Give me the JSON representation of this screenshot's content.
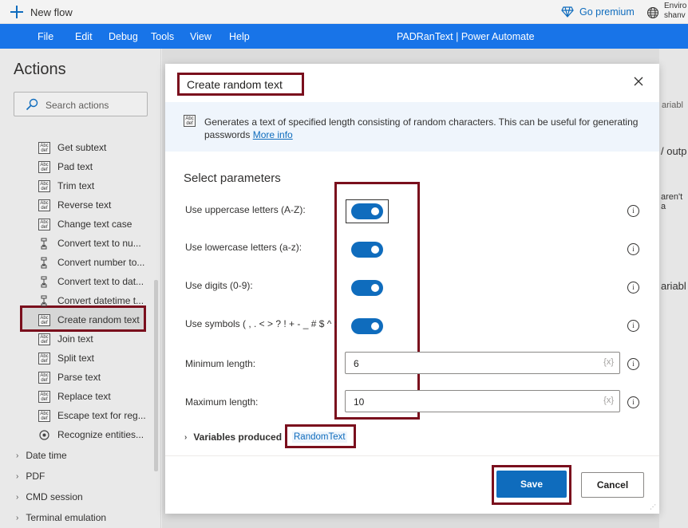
{
  "topbar": {
    "new_flow": "New flow",
    "go_premium": "Go premium",
    "env_line1": "Enviro",
    "env_line2": "shanv"
  },
  "menubar": {
    "items": [
      "File",
      "Edit",
      "Debug",
      "Tools",
      "View",
      "Help"
    ],
    "app_title": "PADRanText | Power Automate"
  },
  "actions": {
    "title": "Actions",
    "search_placeholder": "Search actions",
    "items": [
      {
        "label": "Get subtext",
        "icon": "abc-icon"
      },
      {
        "label": "Pad text",
        "icon": "abc-icon"
      },
      {
        "label": "Trim text",
        "icon": "abc-icon"
      },
      {
        "label": "Reverse text",
        "icon": "abc-icon"
      },
      {
        "label": "Change text case",
        "icon": "abc-icon"
      },
      {
        "label": "Convert text to nu...",
        "icon": "convert-icon"
      },
      {
        "label": "Convert number to...",
        "icon": "convert-icon"
      },
      {
        "label": "Convert text to dat...",
        "icon": "convert-icon"
      },
      {
        "label": "Convert datetime t...",
        "icon": "convert-icon"
      },
      {
        "label": "Create random text",
        "icon": "abc-icon"
      },
      {
        "label": "Join text",
        "icon": "abc-icon"
      },
      {
        "label": "Split text",
        "icon": "abc-icon"
      },
      {
        "label": "Parse text",
        "icon": "abc-icon"
      },
      {
        "label": "Replace text",
        "icon": "abc-icon"
      },
      {
        "label": "Escape text for reg...",
        "icon": "abc-icon"
      },
      {
        "label": "Recognize entities...",
        "icon": "recognize-icon"
      }
    ],
    "groups": [
      "Date time",
      "PDF",
      "CMD session",
      "Terminal emulation"
    ]
  },
  "background": {
    "var_tab_partial": "/ outp",
    "var_text_partial": "aren't a",
    "variables_partial": "ariabl",
    "variables2_partial": "ariabl"
  },
  "dialog": {
    "title": "Create random text",
    "description": "Generates a text of specified length consisting of random characters. This can be useful for generating passwords",
    "more_info": "More info",
    "section_title": "Select parameters",
    "params": [
      {
        "label": "Use uppercase letters (A-Z):",
        "enabled": true
      },
      {
        "label": "Use lowercase letters (a-z):",
        "enabled": true
      },
      {
        "label": "Use digits (0-9):",
        "enabled": true
      },
      {
        "label": "Use symbols ( , . < > ? ! + - _ # $ ^ :",
        "enabled": true
      }
    ],
    "min_length_label": "Minimum length:",
    "min_length_value": "6",
    "max_length_label": "Maximum length:",
    "max_length_value": "10",
    "var_token": "{x}",
    "variables_produced_label": "Variables produced",
    "variable_name": "RandomText",
    "save_label": "Save",
    "cancel_label": "Cancel"
  },
  "colors": {
    "accent": "#0f6cbd",
    "menubar": "#1874e8",
    "highlight_border": "#7a0f1d"
  }
}
